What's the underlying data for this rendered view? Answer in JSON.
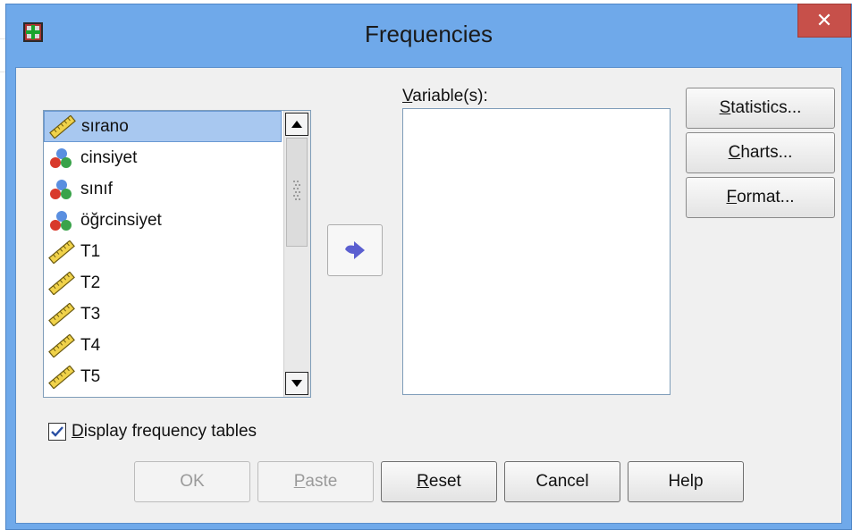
{
  "dialog": {
    "title": "Frequencies",
    "close_label": "✕"
  },
  "source_list": {
    "items": [
      {
        "label": "sırano",
        "icon": "scale-ruler-icon",
        "selected": true
      },
      {
        "label": "cinsiyet",
        "icon": "nominal-balls-icon",
        "selected": false
      },
      {
        "label": "sınıf",
        "icon": "nominal-balls-icon",
        "selected": false
      },
      {
        "label": "öğrcinsiyet",
        "icon": "nominal-balls-icon",
        "selected": false
      },
      {
        "label": "T1",
        "icon": "scale-ruler-icon",
        "selected": false
      },
      {
        "label": "T2",
        "icon": "scale-ruler-icon",
        "selected": false
      },
      {
        "label": "T3",
        "icon": "scale-ruler-icon",
        "selected": false
      },
      {
        "label": "T4",
        "icon": "scale-ruler-icon",
        "selected": false
      },
      {
        "label": "T5",
        "icon": "scale-ruler-icon",
        "selected": false
      }
    ]
  },
  "target": {
    "label_underlined": "V",
    "label_rest": "ariable(s):"
  },
  "side_buttons": {
    "statistics": {
      "u": "S",
      "rest": "tatistics..."
    },
    "charts": {
      "u": "C",
      "rest": "harts..."
    },
    "format": {
      "u": "F",
      "rest": "ormat..."
    }
  },
  "checkbox": {
    "checked": true,
    "label_underlined": "D",
    "label_rest": "isplay frequency tables"
  },
  "bottom_buttons": {
    "ok": "OK",
    "paste_u": "P",
    "paste_rest": "aste",
    "reset_u": "R",
    "reset_rest": "eset",
    "cancel": "Cancel",
    "help": "Help"
  },
  "colors": {
    "window_frame": "#6fa9ea",
    "close_button": "#c7504a",
    "selection": "#a8c8f0",
    "arrow": "#5b5fd0"
  }
}
